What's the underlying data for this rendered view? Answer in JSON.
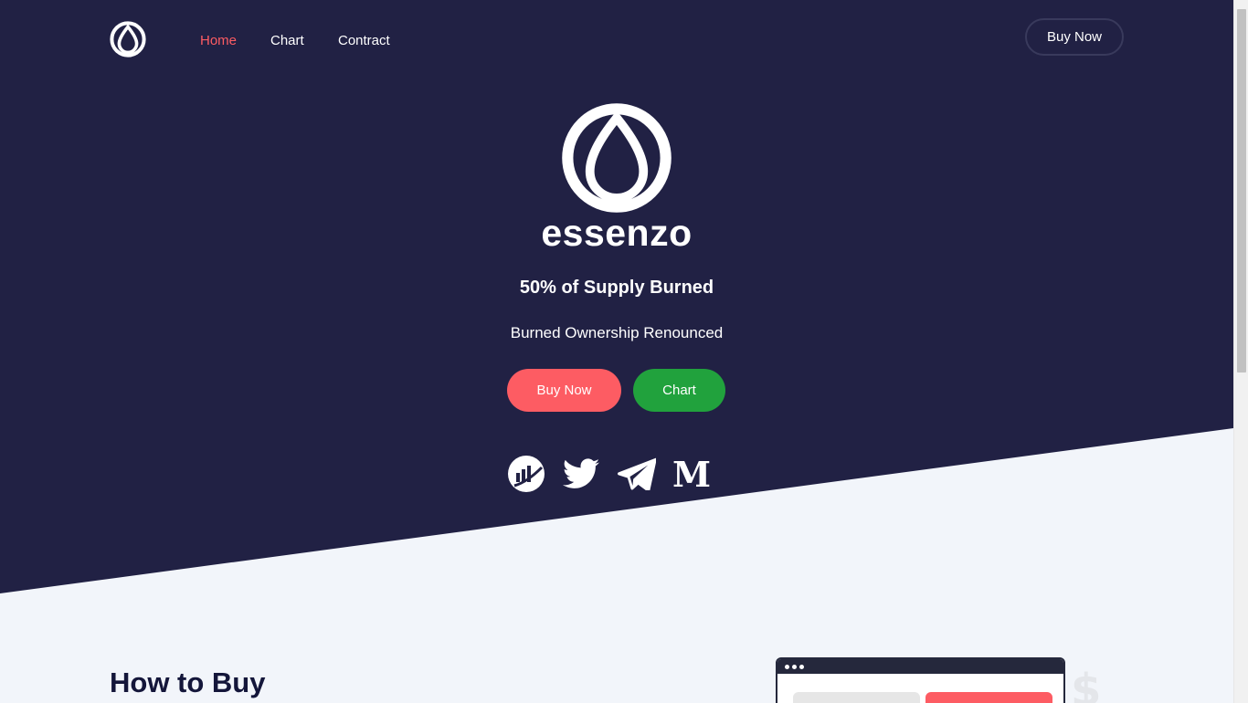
{
  "nav": {
    "links": [
      {
        "label": "Home",
        "active": true
      },
      {
        "label": "Chart",
        "active": false
      },
      {
        "label": "Contract",
        "active": false
      }
    ],
    "buy_label": "Buy Now"
  },
  "hero": {
    "brand": "essenzo",
    "headline": "50% of Supply Burned",
    "subline": "Burned Ownership Renounced",
    "buy_label": "Buy Now",
    "chart_label": "Chart",
    "socials": [
      {
        "icon": "chart-circle-icon"
      },
      {
        "icon": "twitter-icon"
      },
      {
        "icon": "telegram-icon"
      },
      {
        "icon": "medium-icon"
      }
    ]
  },
  "how_to_buy": {
    "title": "How to Buy"
  },
  "colors": {
    "hero_bg": "#212144",
    "accent": "#fd5c63",
    "green": "#21a23d",
    "light_bg": "#f2f5fa",
    "dark_text": "#14163a"
  }
}
